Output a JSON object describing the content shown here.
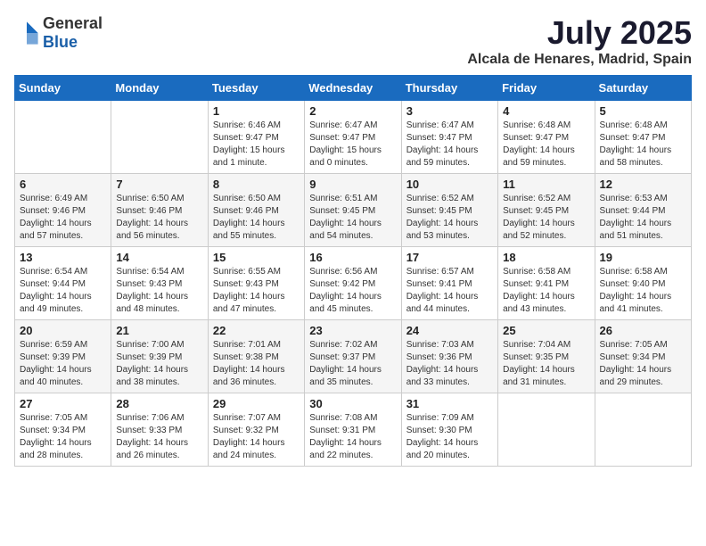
{
  "logo": {
    "text_general": "General",
    "text_blue": "Blue"
  },
  "title": "July 2025",
  "location": "Alcala de Henares, Madrid, Spain",
  "weekdays": [
    "Sunday",
    "Monday",
    "Tuesday",
    "Wednesday",
    "Thursday",
    "Friday",
    "Saturday"
  ],
  "weeks": [
    [
      {
        "day": "",
        "info": ""
      },
      {
        "day": "",
        "info": ""
      },
      {
        "day": "1",
        "info": "Sunrise: 6:46 AM\nSunset: 9:47 PM\nDaylight: 15 hours and 1 minute."
      },
      {
        "day": "2",
        "info": "Sunrise: 6:47 AM\nSunset: 9:47 PM\nDaylight: 15 hours and 0 minutes."
      },
      {
        "day": "3",
        "info": "Sunrise: 6:47 AM\nSunset: 9:47 PM\nDaylight: 14 hours and 59 minutes."
      },
      {
        "day": "4",
        "info": "Sunrise: 6:48 AM\nSunset: 9:47 PM\nDaylight: 14 hours and 59 minutes."
      },
      {
        "day": "5",
        "info": "Sunrise: 6:48 AM\nSunset: 9:47 PM\nDaylight: 14 hours and 58 minutes."
      }
    ],
    [
      {
        "day": "6",
        "info": "Sunrise: 6:49 AM\nSunset: 9:46 PM\nDaylight: 14 hours and 57 minutes."
      },
      {
        "day": "7",
        "info": "Sunrise: 6:50 AM\nSunset: 9:46 PM\nDaylight: 14 hours and 56 minutes."
      },
      {
        "day": "8",
        "info": "Sunrise: 6:50 AM\nSunset: 9:46 PM\nDaylight: 14 hours and 55 minutes."
      },
      {
        "day": "9",
        "info": "Sunrise: 6:51 AM\nSunset: 9:45 PM\nDaylight: 14 hours and 54 minutes."
      },
      {
        "day": "10",
        "info": "Sunrise: 6:52 AM\nSunset: 9:45 PM\nDaylight: 14 hours and 53 minutes."
      },
      {
        "day": "11",
        "info": "Sunrise: 6:52 AM\nSunset: 9:45 PM\nDaylight: 14 hours and 52 minutes."
      },
      {
        "day": "12",
        "info": "Sunrise: 6:53 AM\nSunset: 9:44 PM\nDaylight: 14 hours and 51 minutes."
      }
    ],
    [
      {
        "day": "13",
        "info": "Sunrise: 6:54 AM\nSunset: 9:44 PM\nDaylight: 14 hours and 49 minutes."
      },
      {
        "day": "14",
        "info": "Sunrise: 6:54 AM\nSunset: 9:43 PM\nDaylight: 14 hours and 48 minutes."
      },
      {
        "day": "15",
        "info": "Sunrise: 6:55 AM\nSunset: 9:43 PM\nDaylight: 14 hours and 47 minutes."
      },
      {
        "day": "16",
        "info": "Sunrise: 6:56 AM\nSunset: 9:42 PM\nDaylight: 14 hours and 45 minutes."
      },
      {
        "day": "17",
        "info": "Sunrise: 6:57 AM\nSunset: 9:41 PM\nDaylight: 14 hours and 44 minutes."
      },
      {
        "day": "18",
        "info": "Sunrise: 6:58 AM\nSunset: 9:41 PM\nDaylight: 14 hours and 43 minutes."
      },
      {
        "day": "19",
        "info": "Sunrise: 6:58 AM\nSunset: 9:40 PM\nDaylight: 14 hours and 41 minutes."
      }
    ],
    [
      {
        "day": "20",
        "info": "Sunrise: 6:59 AM\nSunset: 9:39 PM\nDaylight: 14 hours and 40 minutes."
      },
      {
        "day": "21",
        "info": "Sunrise: 7:00 AM\nSunset: 9:39 PM\nDaylight: 14 hours and 38 minutes."
      },
      {
        "day": "22",
        "info": "Sunrise: 7:01 AM\nSunset: 9:38 PM\nDaylight: 14 hours and 36 minutes."
      },
      {
        "day": "23",
        "info": "Sunrise: 7:02 AM\nSunset: 9:37 PM\nDaylight: 14 hours and 35 minutes."
      },
      {
        "day": "24",
        "info": "Sunrise: 7:03 AM\nSunset: 9:36 PM\nDaylight: 14 hours and 33 minutes."
      },
      {
        "day": "25",
        "info": "Sunrise: 7:04 AM\nSunset: 9:35 PM\nDaylight: 14 hours and 31 minutes."
      },
      {
        "day": "26",
        "info": "Sunrise: 7:05 AM\nSunset: 9:34 PM\nDaylight: 14 hours and 29 minutes."
      }
    ],
    [
      {
        "day": "27",
        "info": "Sunrise: 7:05 AM\nSunset: 9:34 PM\nDaylight: 14 hours and 28 minutes."
      },
      {
        "day": "28",
        "info": "Sunrise: 7:06 AM\nSunset: 9:33 PM\nDaylight: 14 hours and 26 minutes."
      },
      {
        "day": "29",
        "info": "Sunrise: 7:07 AM\nSunset: 9:32 PM\nDaylight: 14 hours and 24 minutes."
      },
      {
        "day": "30",
        "info": "Sunrise: 7:08 AM\nSunset: 9:31 PM\nDaylight: 14 hours and 22 minutes."
      },
      {
        "day": "31",
        "info": "Sunrise: 7:09 AM\nSunset: 9:30 PM\nDaylight: 14 hours and 20 minutes."
      },
      {
        "day": "",
        "info": ""
      },
      {
        "day": "",
        "info": ""
      }
    ]
  ]
}
